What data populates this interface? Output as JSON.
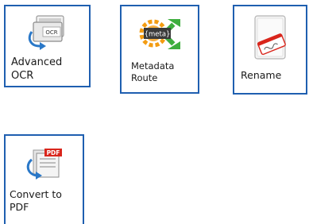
{
  "tiles": [
    {
      "label": "Advanced\nOCR",
      "icon": "ocr-document-icon",
      "icon_text": "OCR"
    },
    {
      "label": "Metadata\nRoute",
      "icon": "metadata-route-icon",
      "icon_text": "{meta}"
    },
    {
      "label": "Rename",
      "icon": "rename-tag-icon"
    },
    {
      "label": "Convert to\nPDF",
      "icon": "convert-pdf-icon",
      "icon_text": "PDF"
    }
  ],
  "colors": {
    "tile_border": "#1f5fb0",
    "label_text": "#1a1a1a",
    "pdf_red": "#d9261c",
    "meta_green": "#3fae3f",
    "meta_orange": "#f39c12",
    "arrow_blue": "#2a78c8"
  }
}
